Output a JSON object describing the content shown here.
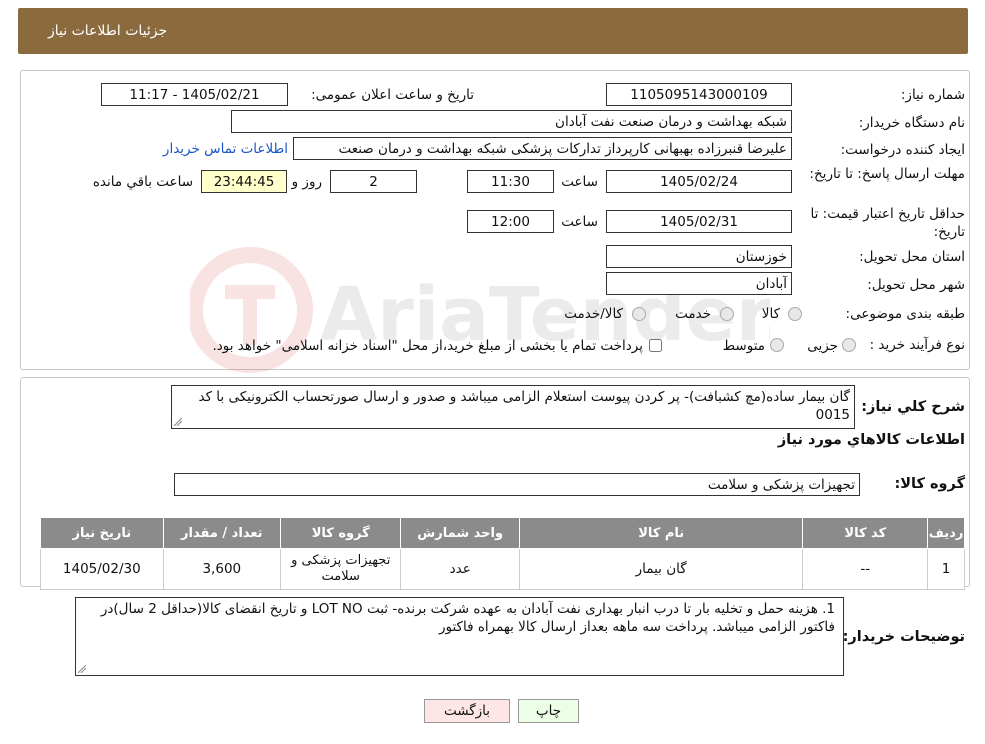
{
  "header": {
    "title": "جزئیات اطلاعات نیاز"
  },
  "form": {
    "need_number_label": "شماره نیاز:",
    "need_number": "1105095143000109",
    "announce_label": "تاریخ و ساعت اعلان عمومی:",
    "announce_value": "1405/02/21 - 11:17",
    "buyer_org_label": "نام دستگاه خریدار:",
    "buyer_org": "شبکه بهداشت و درمان صنعت نفت آبادان",
    "creator_label": "ایجاد کننده درخواست:",
    "creator": "علیرضا قنبرزاده بهبهانی کارپرداز تدارکات پزشکی شبکه بهداشت و درمان صنعت",
    "contact_link": "اطلاعات تماس خریدار",
    "reply_deadline_label": "مهلت ارسال پاسخ: تا تاریخ:",
    "reply_date": "1405/02/24",
    "time_label": "ساعت",
    "reply_time": "11:30",
    "days_value": "2",
    "days_label": "روز و",
    "remaining_time": "23:44:45",
    "remaining_label": "ساعت باقي مانده",
    "price_validity_label": "حداقل تاریخ اعتبار قیمت: تا تاریخ:",
    "price_date": "1405/02/31",
    "price_time": "12:00",
    "province_label": "استان محل تحویل:",
    "province": "خوزستان",
    "city_label": "شهر محل تحویل:",
    "city": "آبادان",
    "category_label": "طبقه بندی موضوعی:",
    "cat_goods": "کالا",
    "cat_service": "خدمت",
    "cat_goods_service": "کالا/خدمت",
    "purchase_type_label": "نوع فرآیند خرید :",
    "pt_partial": "جزیی",
    "pt_medium": "متوسط",
    "pt_note": "پرداخت تمام یا بخشی از مبلغ خرید،از محل \"اسناد خزانه اسلامی\" خواهد بود."
  },
  "description": {
    "label": "شرح کلي نياز:",
    "text": "گان بیمار ساده(مچ کشبافت)- پر کردن پیوست استعلام الزامی میباشد و  صدور  و ارسال صورتحساب الکترونیکی با کد 0015"
  },
  "goods_info_title": "اطلاعات كالاهاي مورد نياز",
  "goods_group": {
    "label": "گروه کالا:",
    "value": "تجهیزات پزشکی و سلامت"
  },
  "table": {
    "headers": [
      "ردیف",
      "کد کالا",
      "نام کالا",
      "واحد شمارش",
      "گروه کالا",
      "تعداد / مقدار",
      "تاریخ نیاز"
    ],
    "rows": [
      [
        "1",
        "--",
        "گان بیمار",
        "عدد",
        "تجهیزات پزشکی و سلامت",
        "3,600",
        "1405/02/30"
      ]
    ]
  },
  "buyer_notes": {
    "label": "توضیحات خریدار:",
    "text": "1.     هزینه حمل و تخلیه بار تا درب انبار بهداری نفت آبادان به عهده شرکت برنده- ثبت LOT NO و تاریخ انقضای کالا(حداقل 2 سال)در فاکتور الزامی میباشد. پرداخت سه ماهه بعداز ارسال کالا بهمراه فاکتور"
  },
  "buttons": {
    "print": "چاپ",
    "back": "بازگشت"
  },
  "watermark": "AriaTender.neT",
  "colors": {
    "header": "#8b6a3e",
    "table_header": "#8b8b8b",
    "link": "#1a56c9",
    "print_btn": "#ecffe6",
    "back_btn": "#ffe6e6"
  }
}
